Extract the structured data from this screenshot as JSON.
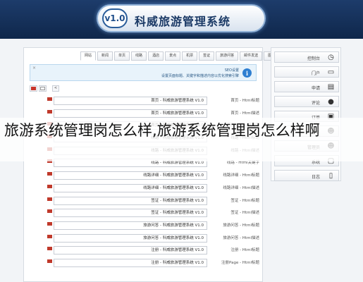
{
  "header": {
    "logo": "v1.0",
    "title": "科威旅游管理系统"
  },
  "tabs": [
    "网站",
    "新闻",
    "单页",
    "线路",
    "酒店",
    "景点",
    "机票",
    "签证",
    "旅游问答",
    "邮件发送",
    "图片管理"
  ],
  "info": {
    "title": "SEO设置",
    "text": "设置页面标题、关键字和描述内容以优化搜索引擎"
  },
  "mini_tools": {
    "right": "<"
  },
  "rows": [
    {
      "value": "首页 - 科威旅游管理系统 V1.0",
      "label": "首页 - Html标题"
    },
    {
      "value": "首页 - 科威旅游管理系统 V1.0",
      "label": "首页 - Html描述"
    },
    {
      "value": "首页 - 科威旅游管理系统 V1.0",
      "label": "首页 - Html关键字"
    },
    {
      "value": "线路 - 科威旅游管理系统 V1.0",
      "label": "线路 - Html标题"
    },
    {
      "value": "线路 - 科威旅游管理系统 V1.0",
      "label": "线路 - Html描述"
    },
    {
      "value": "线路 - 科威旅游管理系统 V1.0",
      "label": "线路 - Html关键字"
    },
    {
      "value": "线路详细 - 科威旅游管理系统 V1.0",
      "label": "线路详细 - Html标题"
    },
    {
      "value": "线路详细 - 科威旅游管理系统 V1.0",
      "label": "线路详细 - Html描述"
    },
    {
      "value": "签证 - 科威旅游管理系统 V1.0",
      "label": "签证 - Html标题"
    },
    {
      "value": "签证 - 科威旅游管理系统 V1.0",
      "label": "签证 - Html描述"
    },
    {
      "value": "旅游问答 - 科威旅游管理系统 V1.0",
      "label": "旅游问答 - Html标题"
    },
    {
      "value": "旅游问答 - 科威旅游管理系统 V1.0",
      "label": "旅游问答 - Html描述"
    },
    {
      "value": "注册 - 科威旅游管理系统 V1.0",
      "label": "注册 - Html标题"
    },
    {
      "value": "注册 - 科威旅游管理系统 V1.0",
      "label": "注册Page - Html标题"
    }
  ],
  "sidebar": [
    {
      "label": "控制台",
      "icon": "clock-icon",
      "glyph": "◷"
    },
    {
      "label": "门户",
      "icon": "folder-icon",
      "glyph": "▭"
    },
    {
      "label": "申请",
      "icon": "clipboard-icon",
      "glyph": "▤"
    },
    {
      "label": "评论",
      "icon": "chat-icon",
      "glyph": "●"
    },
    {
      "label": "订单",
      "icon": "inbox-icon",
      "glyph": "▣"
    },
    {
      "label": "会员",
      "icon": "user-icon",
      "glyph": "☻"
    },
    {
      "label": "管理员",
      "icon": "users-icon",
      "glyph": "☻"
    },
    {
      "label": "系统",
      "icon": "monitor-icon",
      "glyph": "▢"
    },
    {
      "label": "日志",
      "icon": "document-icon",
      "glyph": "▯"
    }
  ],
  "overlay_text": "旅游系统管理岗怎么样,旅游系统管理岗怎么样啊"
}
